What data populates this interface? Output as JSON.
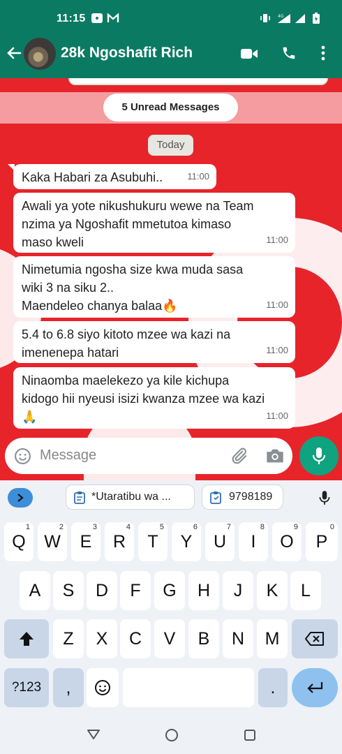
{
  "status_bar": {
    "time": "11:15"
  },
  "header": {
    "contact_name": "28k Ngoshafit Rich"
  },
  "chat": {
    "unread_label": "5 Unread Messages",
    "date_label": "Today",
    "messages": [
      {
        "lines": [
          "Kaka Habari za Asubuhi.."
        ],
        "time": "11:00"
      },
      {
        "lines": [
          "Awali ya yote nikushukuru wewe na Team",
          "nzima ya Ngoshafit mmetutoa kimaso",
          "maso kweli"
        ],
        "time": "11:00"
      },
      {
        "lines": [
          "Nimetumia ngosha size kwa muda sasa",
          "wiki 3 na siku 2..",
          "Maendeleo chanya balaa🔥"
        ],
        "time": "11:00"
      },
      {
        "lines": [
          "5.4 to 6.8 siyo kitoto mzee wa kazi na",
          "imenenepa hatari"
        ],
        "time": "11:00"
      },
      {
        "lines": [
          "Ninaomba maelekezo ya kile kichupa",
          "kidogo hii nyeusi isizi kwanza mzee wa kazi",
          "🙏"
        ],
        "time": "11:00"
      }
    ]
  },
  "composer": {
    "placeholder": "Message"
  },
  "keyboard": {
    "suggestions": [
      "*Utaratibu wa ...",
      "9798189"
    ],
    "row1": [
      {
        "letter": "Q",
        "num": "1"
      },
      {
        "letter": "W",
        "num": "2"
      },
      {
        "letter": "E",
        "num": "3"
      },
      {
        "letter": "R",
        "num": "4"
      },
      {
        "letter": "T",
        "num": "5"
      },
      {
        "letter": "Y",
        "num": "6"
      },
      {
        "letter": "U",
        "num": "7"
      },
      {
        "letter": "I",
        "num": "8"
      },
      {
        "letter": "O",
        "num": "9"
      },
      {
        "letter": "P",
        "num": "0"
      }
    ],
    "row2": [
      "A",
      "S",
      "D",
      "F",
      "G",
      "H",
      "J",
      "K",
      "L"
    ],
    "row3": [
      "Z",
      "X",
      "C",
      "V",
      "B",
      "N",
      "M"
    ],
    "symbols_label": "?123",
    "comma": ",",
    "period": "."
  },
  "icons": {
    "back": "arrow-left-icon",
    "video": "video-call-icon",
    "phone": "phone-icon",
    "menu": "more-vert-icon",
    "emoji": "emoji-icon",
    "attach": "paperclip-icon",
    "camera": "camera-icon",
    "mic": "mic-icon"
  },
  "colors": {
    "header": "#0b7a63",
    "mic_button": "#10a37f",
    "chat_background": "#e7242a"
  }
}
